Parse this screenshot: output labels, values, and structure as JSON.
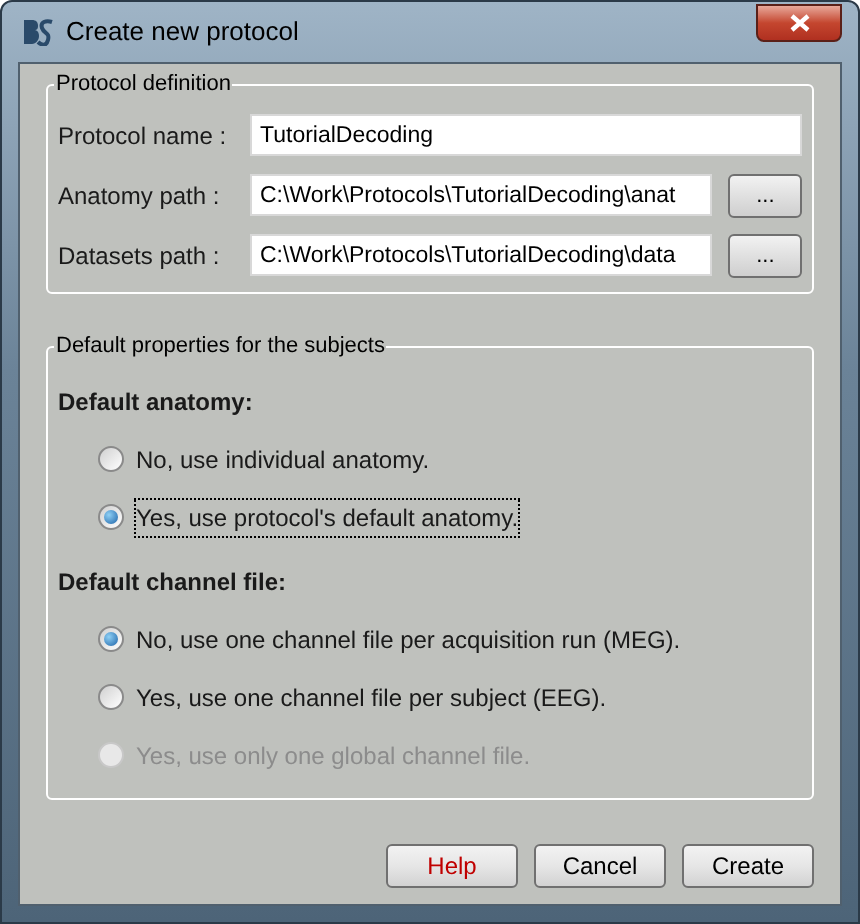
{
  "window": {
    "title": "Create new protocol"
  },
  "protocol_definition": {
    "title": "Protocol definition",
    "fields": [
      {
        "label": "Protocol name :",
        "value": "TutorialDecoding"
      },
      {
        "label": "Anatomy path :",
        "value": "C:\\Work\\Protocols\\TutorialDecoding\\anat",
        "browse_label": "..."
      },
      {
        "label": "Datasets path :",
        "value": "C:\\Work\\Protocols\\TutorialDecoding\\data",
        "browse_label": "..."
      }
    ]
  },
  "default_properties": {
    "title": "Default properties for the subjects",
    "sections": [
      {
        "heading": "Default anatomy:",
        "options": [
          {
            "label": "No, use individual anatomy.",
            "selected": false,
            "disabled": false,
            "focused": false
          },
          {
            "label": "Yes, use protocol's default anatomy.",
            "selected": true,
            "disabled": false,
            "focused": true
          }
        ]
      },
      {
        "heading": "Default channel file:",
        "options": [
          {
            "label": "No, use one channel file per acquisition run (MEG).",
            "selected": true,
            "disabled": false,
            "focused": false
          },
          {
            "label": "Yes, use one channel file per subject (EEG).",
            "selected": false,
            "disabled": false,
            "focused": false
          },
          {
            "label": "Yes, use only one global channel file.",
            "selected": false,
            "disabled": true,
            "focused": false
          }
        ]
      }
    ]
  },
  "buttons": [
    {
      "label": "Help",
      "color": "#c00000"
    },
    {
      "label": "Cancel",
      "color": "#000000"
    },
    {
      "label": "Create",
      "color": "#000000"
    }
  ]
}
